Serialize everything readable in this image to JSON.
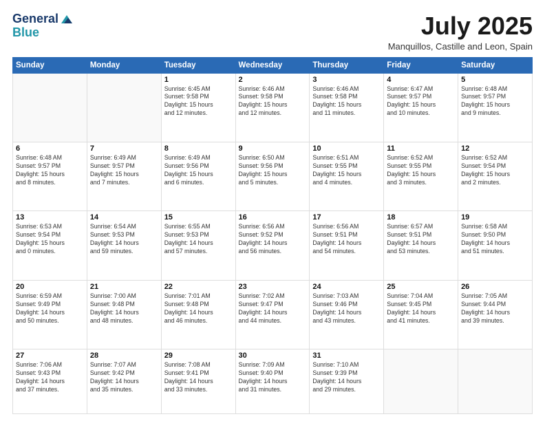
{
  "logo": {
    "line1": "General",
    "line2": "Blue"
  },
  "title": "July 2025",
  "location": "Manquillos, Castille and Leon, Spain",
  "weekdays": [
    "Sunday",
    "Monday",
    "Tuesday",
    "Wednesday",
    "Thursday",
    "Friday",
    "Saturday"
  ],
  "weeks": [
    [
      {
        "day": "",
        "info": ""
      },
      {
        "day": "",
        "info": ""
      },
      {
        "day": "1",
        "info": "Sunrise: 6:45 AM\nSunset: 9:58 PM\nDaylight: 15 hours\nand 12 minutes."
      },
      {
        "day": "2",
        "info": "Sunrise: 6:46 AM\nSunset: 9:58 PM\nDaylight: 15 hours\nand 12 minutes."
      },
      {
        "day": "3",
        "info": "Sunrise: 6:46 AM\nSunset: 9:58 PM\nDaylight: 15 hours\nand 11 minutes."
      },
      {
        "day": "4",
        "info": "Sunrise: 6:47 AM\nSunset: 9:57 PM\nDaylight: 15 hours\nand 10 minutes."
      },
      {
        "day": "5",
        "info": "Sunrise: 6:48 AM\nSunset: 9:57 PM\nDaylight: 15 hours\nand 9 minutes."
      }
    ],
    [
      {
        "day": "6",
        "info": "Sunrise: 6:48 AM\nSunset: 9:57 PM\nDaylight: 15 hours\nand 8 minutes."
      },
      {
        "day": "7",
        "info": "Sunrise: 6:49 AM\nSunset: 9:57 PM\nDaylight: 15 hours\nand 7 minutes."
      },
      {
        "day": "8",
        "info": "Sunrise: 6:49 AM\nSunset: 9:56 PM\nDaylight: 15 hours\nand 6 minutes."
      },
      {
        "day": "9",
        "info": "Sunrise: 6:50 AM\nSunset: 9:56 PM\nDaylight: 15 hours\nand 5 minutes."
      },
      {
        "day": "10",
        "info": "Sunrise: 6:51 AM\nSunset: 9:55 PM\nDaylight: 15 hours\nand 4 minutes."
      },
      {
        "day": "11",
        "info": "Sunrise: 6:52 AM\nSunset: 9:55 PM\nDaylight: 15 hours\nand 3 minutes."
      },
      {
        "day": "12",
        "info": "Sunrise: 6:52 AM\nSunset: 9:54 PM\nDaylight: 15 hours\nand 2 minutes."
      }
    ],
    [
      {
        "day": "13",
        "info": "Sunrise: 6:53 AM\nSunset: 9:54 PM\nDaylight: 15 hours\nand 0 minutes."
      },
      {
        "day": "14",
        "info": "Sunrise: 6:54 AM\nSunset: 9:53 PM\nDaylight: 14 hours\nand 59 minutes."
      },
      {
        "day": "15",
        "info": "Sunrise: 6:55 AM\nSunset: 9:53 PM\nDaylight: 14 hours\nand 57 minutes."
      },
      {
        "day": "16",
        "info": "Sunrise: 6:56 AM\nSunset: 9:52 PM\nDaylight: 14 hours\nand 56 minutes."
      },
      {
        "day": "17",
        "info": "Sunrise: 6:56 AM\nSunset: 9:51 PM\nDaylight: 14 hours\nand 54 minutes."
      },
      {
        "day": "18",
        "info": "Sunrise: 6:57 AM\nSunset: 9:51 PM\nDaylight: 14 hours\nand 53 minutes."
      },
      {
        "day": "19",
        "info": "Sunrise: 6:58 AM\nSunset: 9:50 PM\nDaylight: 14 hours\nand 51 minutes."
      }
    ],
    [
      {
        "day": "20",
        "info": "Sunrise: 6:59 AM\nSunset: 9:49 PM\nDaylight: 14 hours\nand 50 minutes."
      },
      {
        "day": "21",
        "info": "Sunrise: 7:00 AM\nSunset: 9:48 PM\nDaylight: 14 hours\nand 48 minutes."
      },
      {
        "day": "22",
        "info": "Sunrise: 7:01 AM\nSunset: 9:48 PM\nDaylight: 14 hours\nand 46 minutes."
      },
      {
        "day": "23",
        "info": "Sunrise: 7:02 AM\nSunset: 9:47 PM\nDaylight: 14 hours\nand 44 minutes."
      },
      {
        "day": "24",
        "info": "Sunrise: 7:03 AM\nSunset: 9:46 PM\nDaylight: 14 hours\nand 43 minutes."
      },
      {
        "day": "25",
        "info": "Sunrise: 7:04 AM\nSunset: 9:45 PM\nDaylight: 14 hours\nand 41 minutes."
      },
      {
        "day": "26",
        "info": "Sunrise: 7:05 AM\nSunset: 9:44 PM\nDaylight: 14 hours\nand 39 minutes."
      }
    ],
    [
      {
        "day": "27",
        "info": "Sunrise: 7:06 AM\nSunset: 9:43 PM\nDaylight: 14 hours\nand 37 minutes."
      },
      {
        "day": "28",
        "info": "Sunrise: 7:07 AM\nSunset: 9:42 PM\nDaylight: 14 hours\nand 35 minutes."
      },
      {
        "day": "29",
        "info": "Sunrise: 7:08 AM\nSunset: 9:41 PM\nDaylight: 14 hours\nand 33 minutes."
      },
      {
        "day": "30",
        "info": "Sunrise: 7:09 AM\nSunset: 9:40 PM\nDaylight: 14 hours\nand 31 minutes."
      },
      {
        "day": "31",
        "info": "Sunrise: 7:10 AM\nSunset: 9:39 PM\nDaylight: 14 hours\nand 29 minutes."
      },
      {
        "day": "",
        "info": ""
      },
      {
        "day": "",
        "info": ""
      }
    ]
  ]
}
